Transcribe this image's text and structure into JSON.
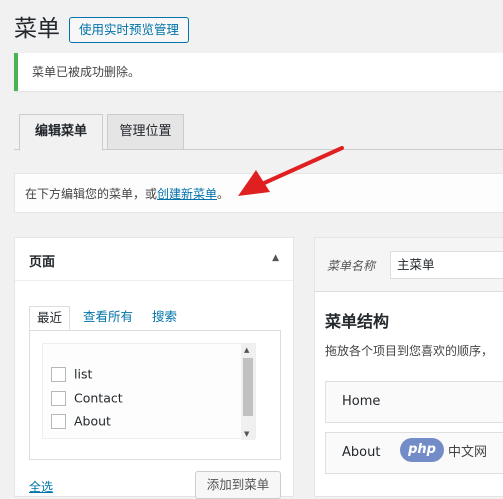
{
  "header": {
    "title": "菜单",
    "live_preview_button": "使用实时预览管理"
  },
  "notice": {
    "text": "菜单已被成功删除。"
  },
  "tabs": [
    {
      "label": "编辑菜单",
      "active": true
    },
    {
      "label": "管理位置",
      "active": false
    }
  ],
  "info": {
    "prefix": "在下方编辑您的菜单，或",
    "link": "创建新菜单",
    "suffix": "。"
  },
  "left_panel": {
    "title": "页面",
    "toggle_icon": "▲",
    "subtabs": [
      "最近",
      "查看所有",
      "搜索"
    ],
    "items": [
      "list",
      "Contact",
      "About"
    ],
    "select_all": "全选",
    "add_button": "添加到菜单"
  },
  "right_panel": {
    "menu_name_label": "菜单名称",
    "menu_name_value": "主菜单",
    "structure_title": "菜单结构",
    "structure_desc": "拖放各个项目到您喜欢的顺序，",
    "menu_items": [
      "Home",
      "About"
    ]
  },
  "watermark": {
    "logo": "php",
    "text": "中文网"
  },
  "colors": {
    "accent": "#0073aa",
    "success": "#46b450",
    "arrow": "#e02020"
  }
}
